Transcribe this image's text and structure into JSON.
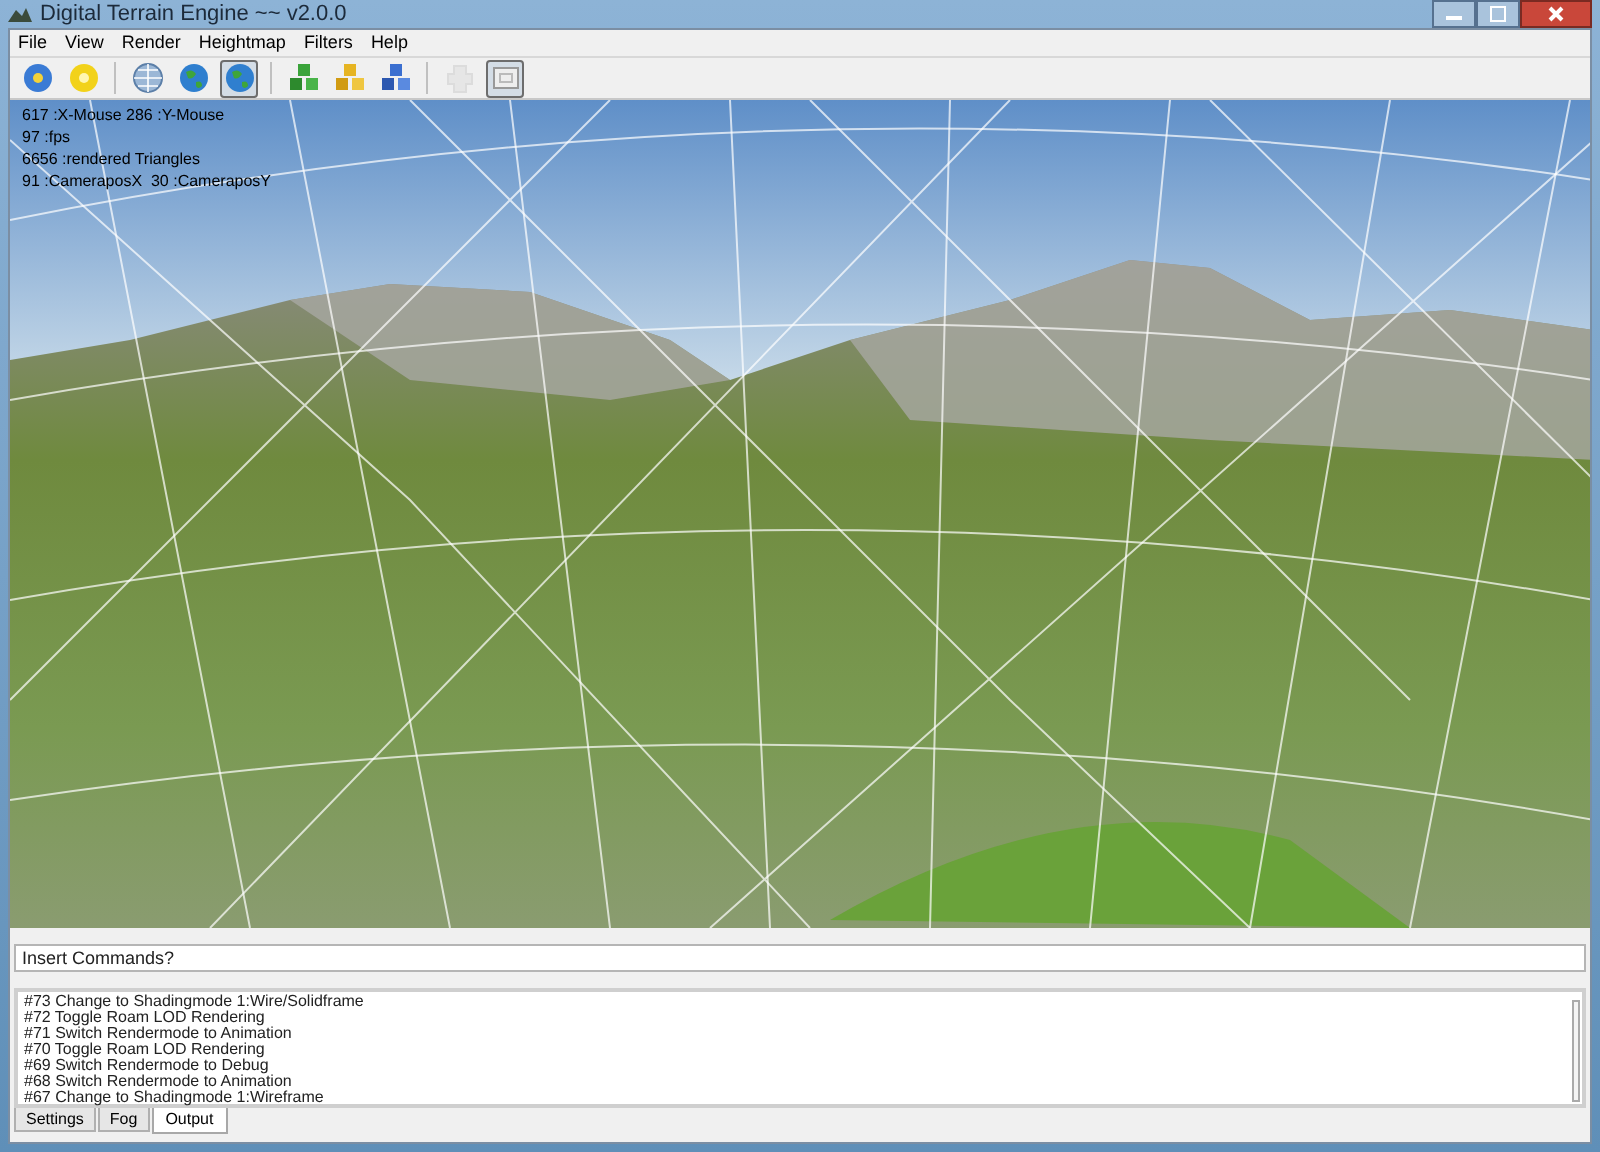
{
  "window": {
    "title": "Digital Terrain Engine ~~ v2.0.0"
  },
  "menu": [
    "File",
    "View",
    "Render",
    "Heightmap",
    "Filters",
    "Help"
  ],
  "toolbar": [
    [
      {
        "kind": "blue-disc",
        "pressed": false,
        "disabled": false
      },
      {
        "kind": "yellow-disc",
        "pressed": false,
        "disabled": false
      }
    ],
    [
      {
        "kind": "wire-globe",
        "pressed": false,
        "disabled": false
      },
      {
        "kind": "globe",
        "pressed": false,
        "disabled": false
      },
      {
        "kind": "globe",
        "pressed": true,
        "disabled": false
      }
    ],
    [
      {
        "kind": "green-cubes",
        "pressed": false,
        "disabled": false
      },
      {
        "kind": "yellow-cubes",
        "pressed": false,
        "disabled": false
      },
      {
        "kind": "blue-cubes",
        "pressed": false,
        "disabled": false
      }
    ],
    [
      {
        "kind": "puzzle",
        "pressed": false,
        "disabled": true
      },
      {
        "kind": "frame",
        "pressed": true,
        "disabled": false
      }
    ]
  ],
  "overlay": [
    "617 :X-Mouse 286 :Y-Mouse",
    "97 :fps",
    "6656 :rendered Triangles",
    "91 :CameraposX  30 :CameraposY"
  ],
  "command": {
    "placeholder": "Insert Commands?"
  },
  "output": [
    "#73 Change to Shadingmode 1:Wire/Solidframe",
    "#72 Toggle Roam LOD Rendering",
    "#71 Switch Rendermode to Animation",
    "#70 Toggle Roam LOD Rendering",
    "#69 Switch Rendermode to Debug",
    "#68 Switch Rendermode to Animation",
    "#67 Change to Shadingmode 1:Wireframe"
  ],
  "tabs": [
    {
      "label": "Settings",
      "selected": false
    },
    {
      "label": "Fog",
      "selected": false
    },
    {
      "label": "Output",
      "selected": true
    }
  ]
}
